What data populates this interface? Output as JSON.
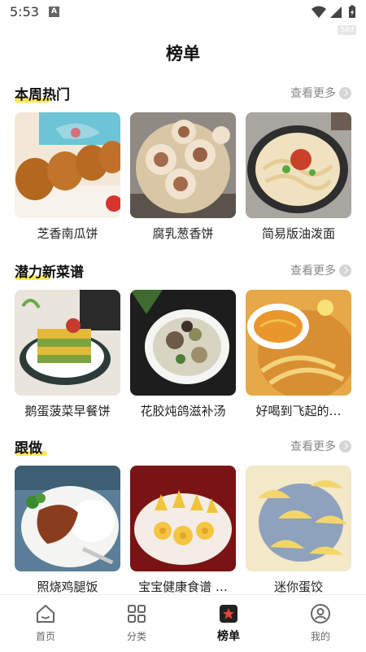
{
  "status_bar": {
    "time": "5:53",
    "notification_letter": "A",
    "fps_badge": "54d"
  },
  "page": {
    "title": "榜单"
  },
  "sections": [
    {
      "title": "本周热门",
      "more_label": "查看更多",
      "items": [
        {
          "title": "芝香南瓜饼"
        },
        {
          "title": "腐乳葱香饼"
        },
        {
          "title": "简易版油泼面"
        }
      ]
    },
    {
      "title": "潜力新菜谱",
      "more_label": "查看更多",
      "items": [
        {
          "title": "鹅蛋菠菜早餐饼"
        },
        {
          "title": "花胶炖鸽滋补汤"
        },
        {
          "title": "好喝到飞起的…"
        }
      ]
    },
    {
      "title": "跟做",
      "more_label": "查看更多",
      "items": [
        {
          "title": "照烧鸡腿饭"
        },
        {
          "title": "宝宝健康食谱 …"
        },
        {
          "title": "迷你蛋饺"
        }
      ]
    }
  ],
  "tabbar": {
    "accent_color": "#e8443a",
    "items": [
      {
        "label": "首页",
        "icon": "home-icon"
      },
      {
        "label": "分类",
        "icon": "grid-icon"
      },
      {
        "label": "榜单",
        "icon": "ranking-star-icon",
        "active": true
      },
      {
        "label": "我的",
        "icon": "profile-icon"
      }
    ]
  }
}
